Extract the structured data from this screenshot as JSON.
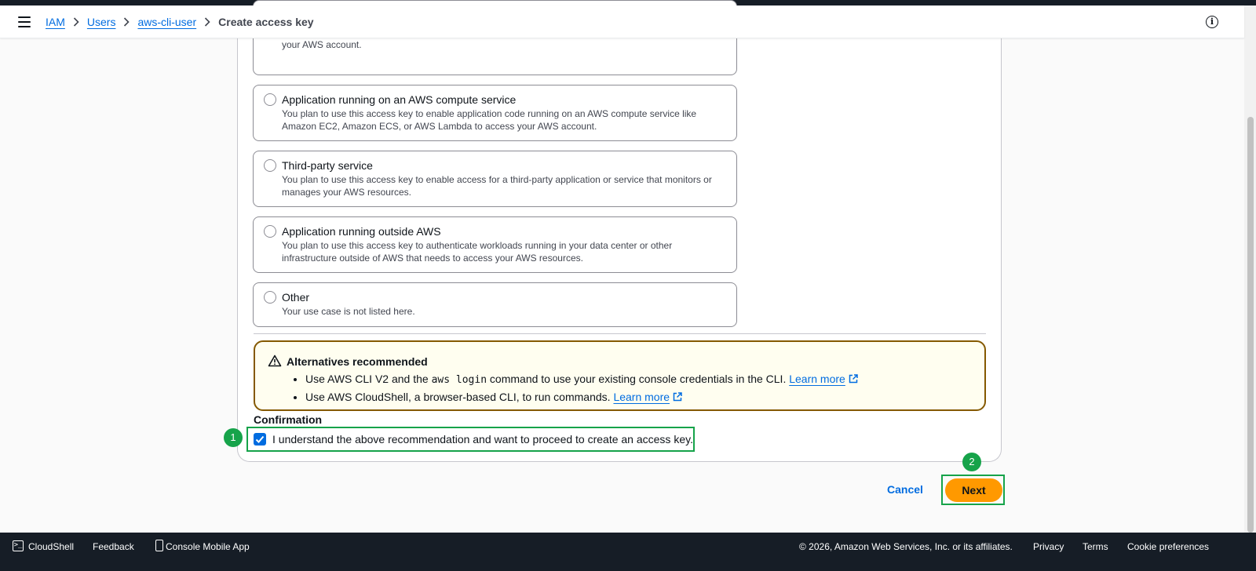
{
  "header": {
    "breadcrumbs": [
      "IAM",
      "Users",
      "aws-cli-user"
    ],
    "current": "Create access key"
  },
  "options": [
    {
      "title": "",
      "description": "You plan to use this access key to enable application code in a local development environment to access your AWS account."
    },
    {
      "title": "Application running on an AWS compute service",
      "description": "You plan to use this access key to enable application code running on an AWS compute service like Amazon EC2, Amazon ECS, or AWS Lambda to access your AWS account."
    },
    {
      "title": "Third-party service",
      "description": "You plan to use this access key to enable access for a third-party application or service that monitors or manages your AWS resources."
    },
    {
      "title": "Application running outside AWS",
      "description": "You plan to use this access key to authenticate workloads running in your data center or other infrastructure outside of AWS that needs to access your AWS resources."
    },
    {
      "title": "Other",
      "description": "Your use case is not listed here."
    }
  ],
  "alert": {
    "title": "Alternatives recommended",
    "item1_pre": "Use AWS CLI V2 and the",
    "item1_code": "aws login",
    "item1_post": "command to use your existing console credentials in the CLI.",
    "item2_pre": "Use AWS CloudShell, a browser-based CLI, to run commands.",
    "learn_more": "Learn more"
  },
  "confirmation": {
    "label": "Confirmation",
    "checkbox_text": "I understand the above recommendation and want to proceed to create an access key.",
    "checked": true
  },
  "annotations": {
    "step1": "1",
    "step2": "2"
  },
  "actions": {
    "cancel": "Cancel",
    "next": "Next"
  },
  "footer": {
    "cloudshell": "CloudShell",
    "feedback": "Feedback",
    "mobile_app": "Console Mobile App",
    "copyright": "© 2026, Amazon Web Services, Inc. or its affiliates.",
    "privacy": "Privacy",
    "terms": "Terms",
    "cookies": "Cookie preferences"
  },
  "colors": {
    "accent": "#006ce0",
    "primary_button": "#ff9900",
    "annotation": "#16a34a",
    "warning_border": "#855900"
  }
}
